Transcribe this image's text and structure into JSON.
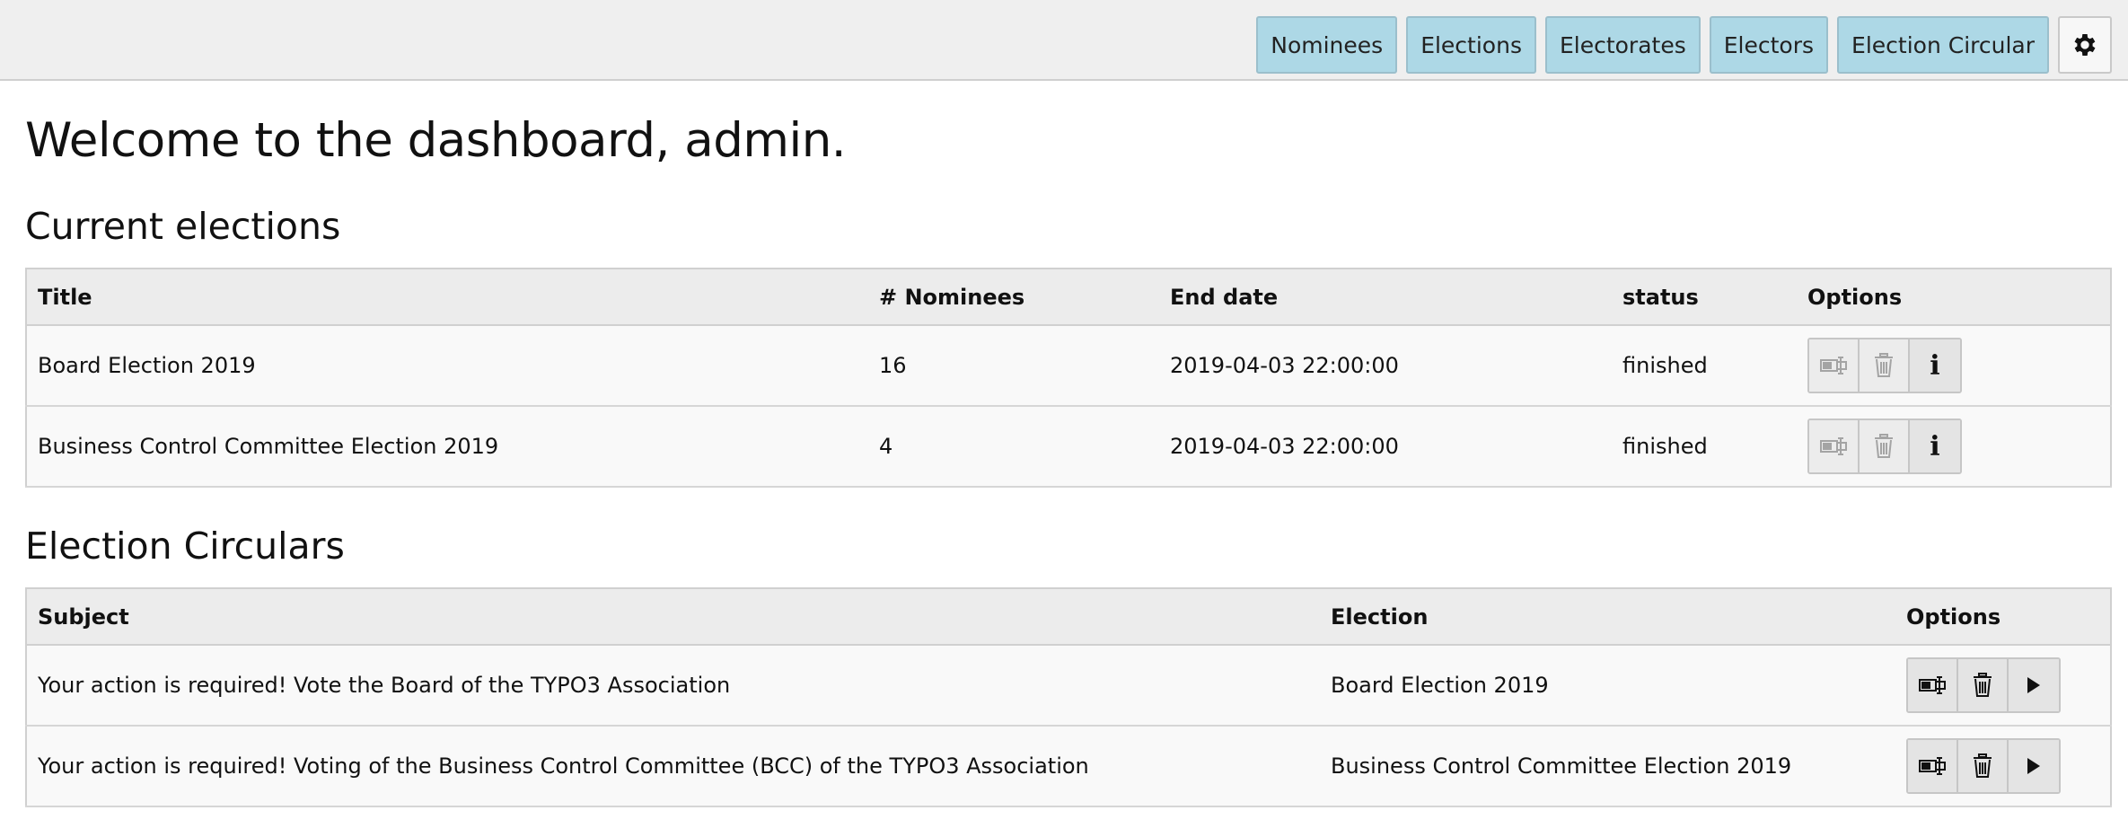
{
  "nav": {
    "items": [
      {
        "label": "Nominees"
      },
      {
        "label": "Elections"
      },
      {
        "label": "Electorates"
      },
      {
        "label": "Electors"
      },
      {
        "label": "Election Circular"
      }
    ],
    "settings_icon": "gear-icon"
  },
  "page": {
    "welcome": "Welcome to the dashboard, admin."
  },
  "current_elections": {
    "heading": "Current elections",
    "columns": {
      "title": "Title",
      "nominees": "# Nominees",
      "end_date": "End date",
      "status": "status",
      "options": "Options"
    },
    "rows": [
      {
        "title": "Board Election 2019",
        "nominees": "16",
        "end_date": "2019-04-03 22:00:00",
        "status": "finished"
      },
      {
        "title": "Business Control Committee Election 2019",
        "nominees": "4",
        "end_date": "2019-04-03 22:00:00",
        "status": "finished"
      }
    ],
    "option_icons": [
      "edit-icon",
      "trash-icon",
      "info-icon"
    ],
    "info_glyph": "i"
  },
  "circulars": {
    "heading": "Election Circulars",
    "columns": {
      "subject": "Subject",
      "election": "Election",
      "options": "Options"
    },
    "rows": [
      {
        "subject": "Your action is required! Vote the Board of the TYPO3 Association",
        "election": "Board Election 2019"
      },
      {
        "subject": "Your action is required! Voting of the Business Control Committee (BCC) of the TYPO3 Association",
        "election": "Business Control Committee Election 2019"
      }
    ],
    "option_icons": [
      "edit-icon",
      "trash-icon",
      "play-icon"
    ]
  },
  "colors": {
    "nav_button_bg": "#add8e6",
    "topbar_bg": "#efefef",
    "header_row_bg": "#ececec"
  }
}
